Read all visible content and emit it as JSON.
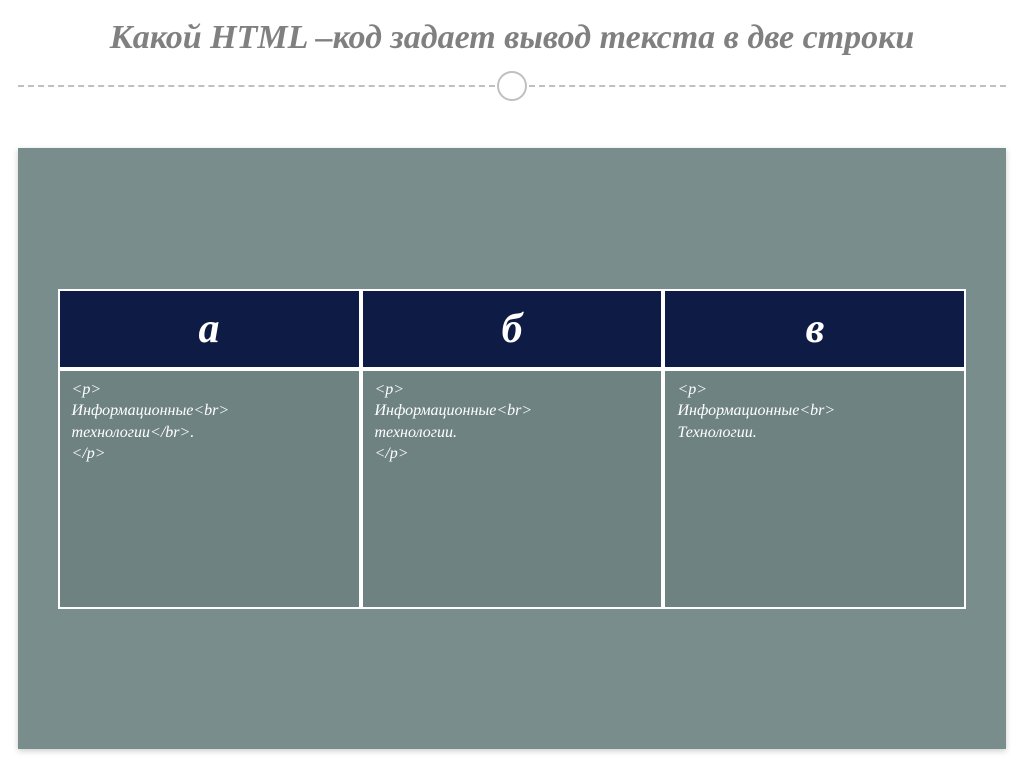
{
  "title": "Какой HTML –код задает вывод текста в две строки",
  "columns": [
    {
      "header": "а",
      "lines": [
        "<p>",
        "Информационные<br>",
        "технологии</br>.",
        "</p>"
      ]
    },
    {
      "header": "б",
      "lines": [
        "<p>",
        "Информационные<br>",
        "технологии.",
        "</p>"
      ]
    },
    {
      "header": "в",
      "lines": [
        "<p>",
        "Информационные<br>",
        "Технологии."
      ]
    }
  ]
}
